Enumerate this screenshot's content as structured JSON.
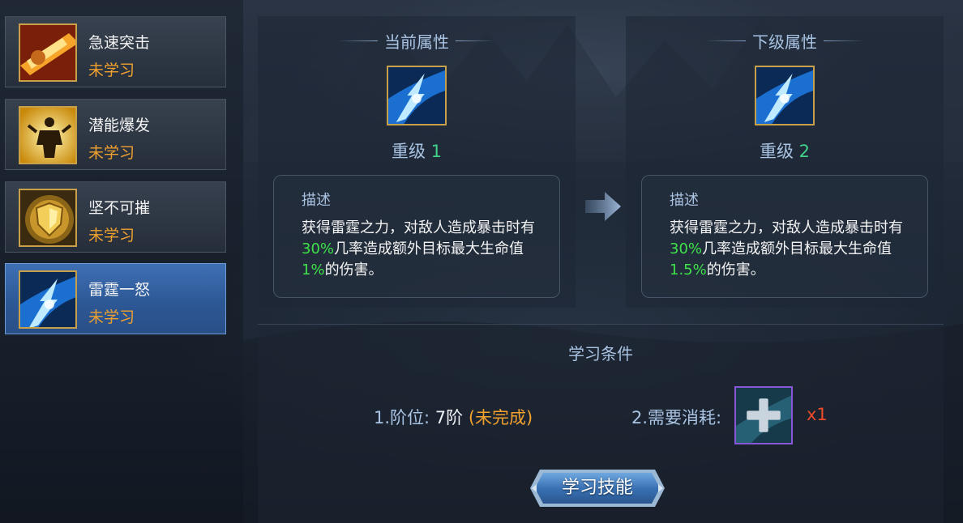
{
  "skills": [
    {
      "name": "急速突击",
      "status": "未学习",
      "icon": "charge-dash-icon",
      "active": false
    },
    {
      "name": "潜能爆发",
      "status": "未学习",
      "icon": "potential-burst-icon",
      "active": false
    },
    {
      "name": "坚不可摧",
      "status": "未学习",
      "icon": "golden-shield-icon",
      "active": false
    },
    {
      "name": "雷霆一怒",
      "status": "未学习",
      "icon": "lightning-strike-icon",
      "active": true
    }
  ],
  "current": {
    "title": "当前属性",
    "level_label": "重级",
    "level_num": "1",
    "desc_title": "描述",
    "desc_part1": "获得雷霆之力，对敌人造成暴击时有",
    "desc_hl1": "30%",
    "desc_part2": "几率造成额外目标最大生命值",
    "desc_hl2": "1%",
    "desc_part3": "的伤害。"
  },
  "next": {
    "title": "下级属性",
    "level_label": "重级",
    "level_num": "2",
    "desc_title": "描述",
    "desc_part1": "获得雷霆之力，对敌人造成暴击时有",
    "desc_hl1": "30%",
    "desc_part2": "几率造成额外目标最大生命值",
    "desc_hl2": "1.5%",
    "desc_part3": "的伤害。"
  },
  "conditions": {
    "title": "学习条件",
    "cond1_label": "1.阶位: ",
    "cond1_value": "7阶",
    "cond1_state": "(未完成)",
    "cond2_label": "2.需要消耗:",
    "item_icon": "skill-book-plus-icon",
    "item_count": "x1"
  },
  "learn_button": "学习技能",
  "colors": {
    "accent": "#a9c3e2",
    "highlight": "#3ee24a",
    "warning": "#f0a12e",
    "level": "#40d28a",
    "count": "#f04a2a",
    "icon_border": "#c9a04a",
    "item_border": "#8a56d8"
  }
}
